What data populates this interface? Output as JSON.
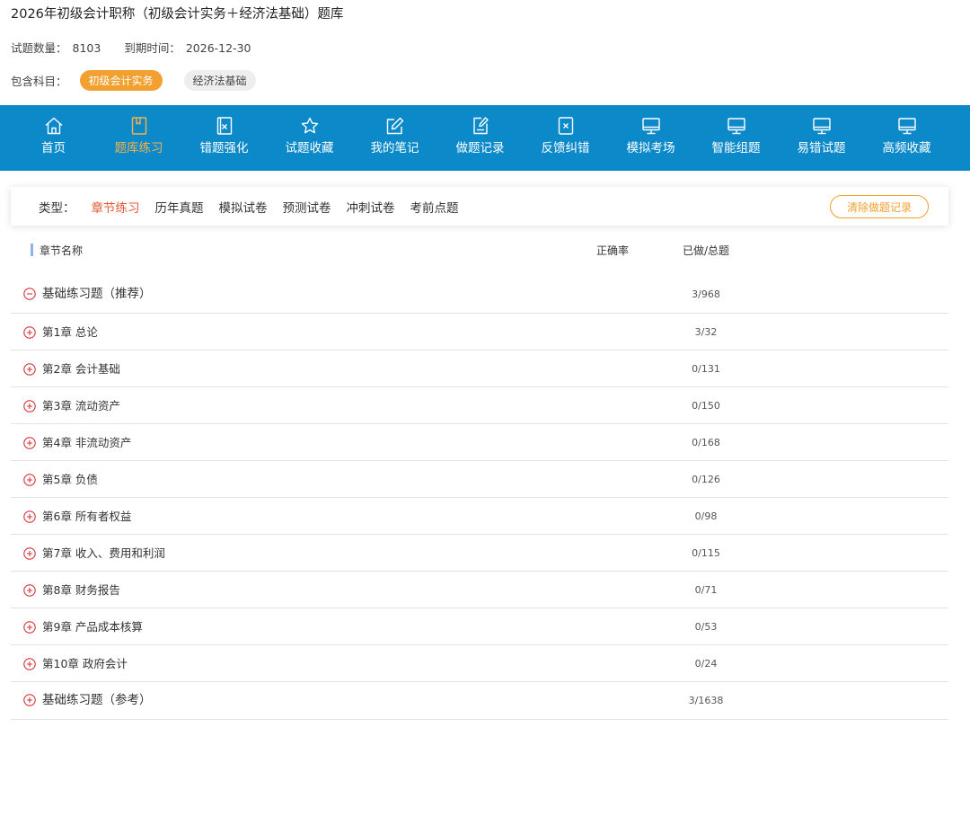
{
  "header": {
    "title": "2026年初级会计职称（初级会计实务＋经济法基础）题库",
    "count_label": "试题数量：",
    "count_value": "8103",
    "expire_label": "到期时间：",
    "expire_value": "2026-12-30",
    "subjects_label": "包含科目：",
    "subjects": [
      {
        "label": "初级会计实务",
        "active": true
      },
      {
        "label": "经济法基础",
        "active": false
      }
    ]
  },
  "nav": {
    "items": [
      {
        "label": "首页",
        "icon": "home-icon"
      },
      {
        "label": "题库练习",
        "icon": "book-icon",
        "active": true
      },
      {
        "label": "错题强化",
        "icon": "wrong-doc-icon"
      },
      {
        "label": "试题收藏",
        "icon": "star-icon"
      },
      {
        "label": "我的笔记",
        "icon": "edit-icon"
      },
      {
        "label": "做题记录",
        "icon": "record-icon"
      },
      {
        "label": "反馈纠错",
        "icon": "feedback-icon"
      },
      {
        "label": "模拟考场",
        "icon": "monitor-icon"
      },
      {
        "label": "智能组题",
        "icon": "monitor-icon"
      },
      {
        "label": "易错试题",
        "icon": "monitor-icon"
      },
      {
        "label": "高频收藏",
        "icon": "monitor-icon"
      }
    ]
  },
  "types": {
    "label": "类型：",
    "items": [
      {
        "label": "章节练习",
        "active": true
      },
      {
        "label": "历年真题"
      },
      {
        "label": "模拟试卷"
      },
      {
        "label": "预测试卷"
      },
      {
        "label": "冲刺试卷"
      },
      {
        "label": "考前点题"
      }
    ],
    "clear_button": "清除做题记录"
  },
  "table": {
    "col_name": "章节名称",
    "col_accuracy": "正确率",
    "col_progress": "已做/总题",
    "rows": [
      {
        "name": "基础练习题（推荐）",
        "progress": "3/968",
        "group": true,
        "expanded": true
      },
      {
        "name": "第1章 总论",
        "progress": "3/32"
      },
      {
        "name": "第2章 会计基础",
        "progress": "0/131"
      },
      {
        "name": "第3章 流动资产",
        "progress": "0/150"
      },
      {
        "name": "第4章 非流动资产",
        "progress": "0/168"
      },
      {
        "name": "第5章 负债",
        "progress": "0/126"
      },
      {
        "name": "第6章 所有者权益",
        "progress": "0/98"
      },
      {
        "name": "第7章 收入、费用和利润",
        "progress": "0/115"
      },
      {
        "name": "第8章 财务报告",
        "progress": "0/71"
      },
      {
        "name": "第9章 产品成本核算",
        "progress": "0/53"
      },
      {
        "name": "第10章 政府会计",
        "progress": "0/24"
      },
      {
        "name": "基础练习题（参考）",
        "progress": "3/1638",
        "group": true,
        "expanded": false
      }
    ]
  },
  "colors": {
    "nav_bg": "#0c89c9",
    "accent_orange": "#f2a02f",
    "active_type": "#e35b35",
    "icon_red": "#d7333b"
  }
}
